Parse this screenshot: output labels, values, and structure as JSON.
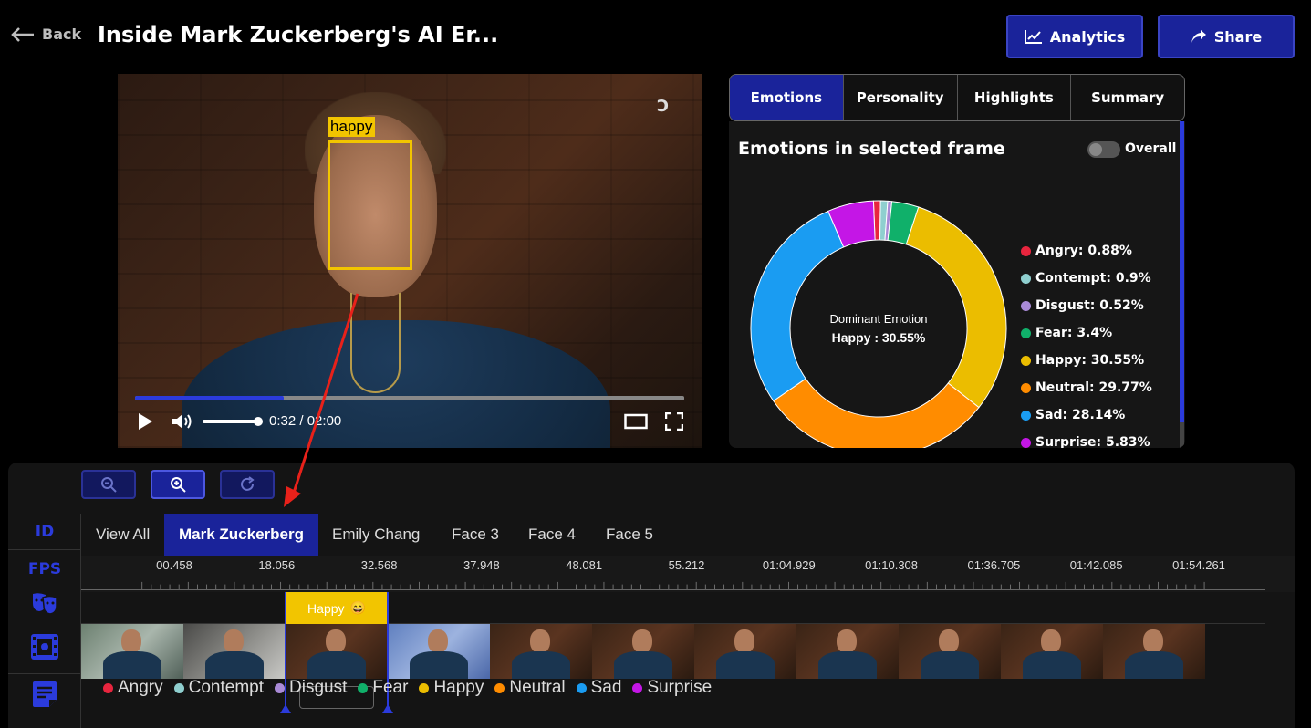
{
  "header": {
    "back_label": "Back",
    "title": "Inside Mark Zuckerberg's AI Er...",
    "analytics_label": "Analytics",
    "share_label": "Share"
  },
  "video": {
    "face_label": "happy",
    "current_time": "0:32",
    "separator": "/",
    "duration": "02:00",
    "progress": 0.27,
    "volume": 1.0
  },
  "panel": {
    "tabs": [
      "Emotions",
      "Personality",
      "Highlights",
      "Summary"
    ],
    "active_tab": "Emotions",
    "title": "Emotions in selected frame",
    "overall_label": "Overall",
    "overall_enabled": false,
    "donut_center_caption": "Dominant Emotion",
    "donut_center_value": "Happy : 30.55%"
  },
  "chart_data": {
    "type": "pie",
    "title": "Emotions in selected frame",
    "center_text": [
      "Dominant Emotion",
      "Happy : 30.55%"
    ],
    "slices": [
      {
        "label": "Angry",
        "value": 0.88,
        "color": "#e8253e",
        "legend": "Angry: 0.88%"
      },
      {
        "label": "Contempt",
        "value": 0.9,
        "color": "#8fcfcf",
        "legend": "Contempt: 0.9%"
      },
      {
        "label": "Disgust",
        "value": 0.52,
        "color": "#a98ad6",
        "legend": "Disgust: 0.52%"
      },
      {
        "label": "Fear",
        "value": 3.4,
        "color": "#10b06a",
        "legend": "Fear: 3.4%"
      },
      {
        "label": "Happy",
        "value": 30.55,
        "color": "#ebbd00",
        "legend": "Happy: 30.55%"
      },
      {
        "label": "Neutral",
        "value": 29.77,
        "color": "#ff8c00",
        "legend": "Neutral: 29.77%"
      },
      {
        "label": "Sad",
        "value": 28.14,
        "color": "#1a9cf2",
        "legend": "Sad: 28.14%"
      },
      {
        "label": "Surprise",
        "value": 5.83,
        "color": "#c416e6",
        "legend": "Surprise: 5.83%"
      }
    ],
    "legend_placement": "right"
  },
  "timeline": {
    "side_labels": {
      "id": "ID",
      "fps": "FPS"
    },
    "face_tabs": [
      "View All",
      "Mark Zuckerberg",
      "Emily Chang",
      "Face 3",
      "Face 4",
      "Face 5"
    ],
    "active_face": "Mark Zuckerberg",
    "ruler_labels": [
      "00.458",
      "18.056",
      "32.568",
      "37.948",
      "48.081",
      "55.212",
      "01:04.929",
      "01:10.308",
      "01:36.705",
      "01:42.085",
      "01:54.261"
    ],
    "segment_label": "Happy",
    "segment_emoji": "😄",
    "thumbnail_count": 11,
    "legend": [
      {
        "label": "Angry",
        "color": "#e8253e"
      },
      {
        "label": "Contempt",
        "color": "#8fcfcf"
      },
      {
        "label": "Disgust",
        "color": "#a98ad6"
      },
      {
        "label": "Fear",
        "color": "#10b06a"
      },
      {
        "label": "Happy",
        "color": "#ebbd00"
      },
      {
        "label": "Neutral",
        "color": "#ff8c00"
      },
      {
        "label": "Sad",
        "color": "#1a9cf2"
      },
      {
        "label": "Surprise",
        "color": "#c416e6"
      }
    ]
  },
  "colors": {
    "accent": "#1a239a",
    "accent_bright": "#2b3bdc",
    "highlight": "#f2c500",
    "arrow": "#e8211a"
  }
}
